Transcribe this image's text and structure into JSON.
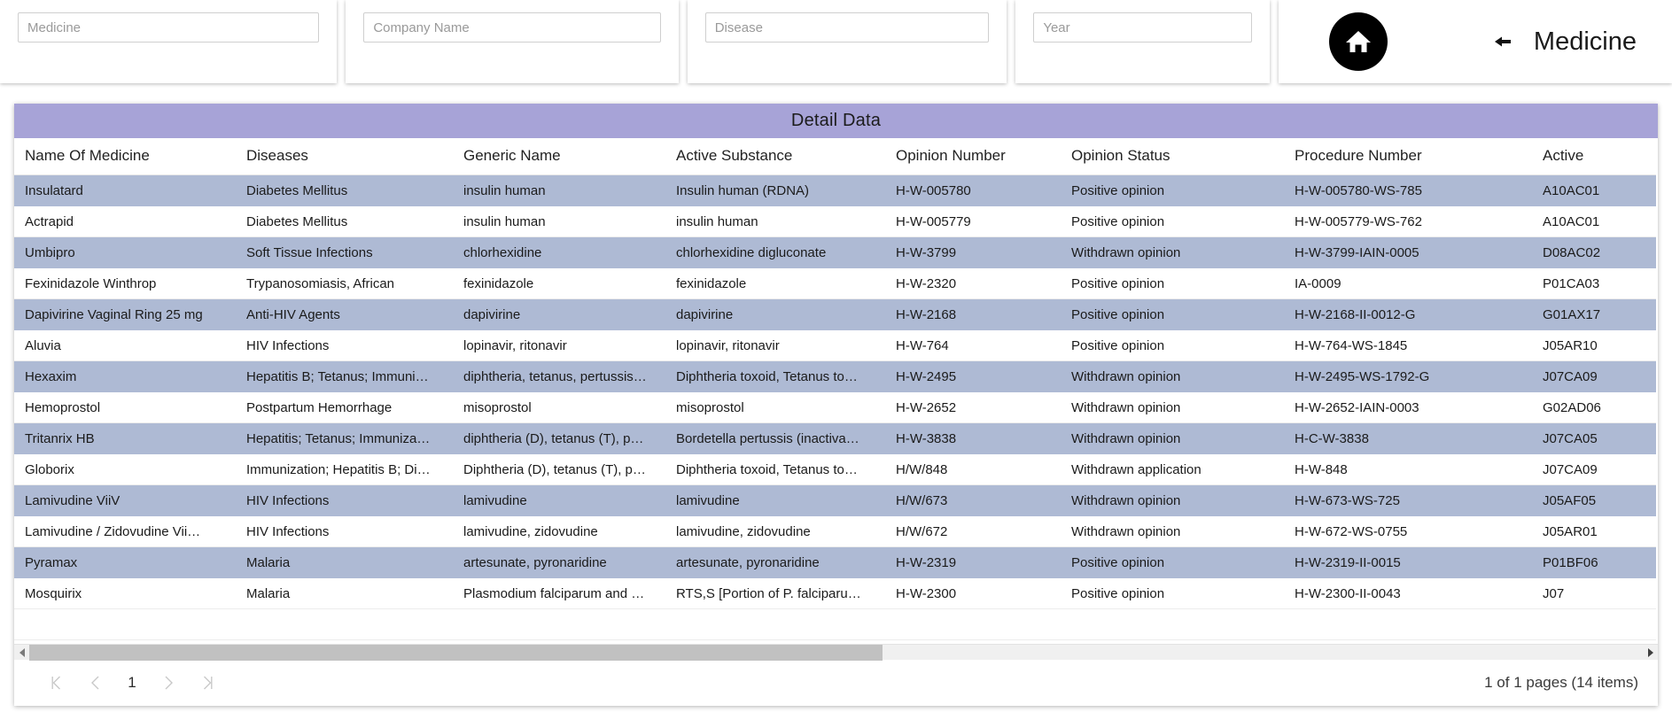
{
  "filters": [
    {
      "name": "medicine",
      "placeholder": "Medicine",
      "value": ""
    },
    {
      "name": "company-name",
      "placeholder": "Company Name",
      "value": ""
    },
    {
      "name": "disease",
      "placeholder": "Disease",
      "value": ""
    },
    {
      "name": "year",
      "placeholder": "Year",
      "value": ""
    }
  ],
  "header": {
    "home_icon": "home-icon",
    "back_icon": "arrow-left-icon",
    "title": "Medicine"
  },
  "grid": {
    "title": "Detail Data",
    "columns": [
      "Name Of Medicine",
      "Diseases",
      "Generic Name",
      "Active Substance",
      "Opinion Number",
      "Opinion Status",
      "Procedure Number",
      "Active"
    ],
    "rows": [
      [
        "Insulatard",
        "Diabetes Mellitus",
        "insulin human",
        "Insulin human (RDNA)",
        "H-W-005780",
        "Positive opinion",
        "H-W-005780-WS-785",
        "A10AC01"
      ],
      [
        "Actrapid",
        "Diabetes Mellitus",
        "insulin human",
        "insulin human",
        "H-W-005779",
        "Positive opinion",
        "H-W-005779-WS-762",
        "A10AC01"
      ],
      [
        "Umbipro",
        "Soft Tissue Infections",
        "chlorhexidine",
        "chlorhexidine digluconate",
        "H-W-3799",
        "Withdrawn opinion",
        "H-W-3799-IAIN-0005",
        "D08AC02"
      ],
      [
        "Fexinidazole Winthrop",
        "Trypanosomiasis, African",
        "fexinidazole",
        "fexinidazole",
        "H-W-2320",
        "Positive opinion",
        "IA-0009",
        "P01CA03"
      ],
      [
        "Dapivirine Vaginal Ring 25 mg",
        "Anti-HIV Agents",
        "dapivirine",
        "dapivirine",
        "H-W-2168",
        "Positive opinion",
        "H-W-2168-II-0012-G",
        "G01AX17"
      ],
      [
        "Aluvia",
        "HIV Infections",
        "lopinavir, ritonavir",
        "lopinavir, ritonavir",
        "H-W-764",
        "Positive opinion",
        "H-W-764-WS-1845",
        "J05AR10"
      ],
      [
        "Hexaxim",
        "Hepatitis B; Tetanus; Immuni…",
        "diphtheria, tetanus, pertussis…",
        "Diphtheria toxoid, Tetanus to…",
        "H-W-2495",
        "Withdrawn opinion",
        "H-W-2495-WS-1792-G",
        "J07CA09"
      ],
      [
        "Hemoprostol",
        "Postpartum Hemorrhage",
        "misoprostol",
        "misoprostol",
        "H-W-2652",
        "Withdrawn opinion",
        "H-W-2652-IAIN-0003",
        "G02AD06"
      ],
      [
        "Tritanrix HB",
        "Hepatitis; Tetanus; Immuniza…",
        "diphtheria (D), tetanus (T), p…",
        "Bordetella pertussis (inactiva…",
        "H-W-3838",
        "Withdrawn opinion",
        "H-C-W-3838",
        "J07CA05"
      ],
      [
        "Globorix",
        "Immunization; Hepatitis B; Di…",
        "Diphtheria (D), tetanus (T), p…",
        "Diphtheria toxoid, Tetanus to…",
        "H/W/848",
        "Withdrawn application",
        "H-W-848",
        "J07CA09"
      ],
      [
        "Lamivudine ViiV",
        "HIV Infections",
        "lamivudine",
        "lamivudine",
        "H/W/673",
        "Withdrawn opinion",
        "H-W-673-WS-725",
        "J05AF05"
      ],
      [
        "Lamivudine / Zidovudine Vii…",
        "HIV Infections",
        "lamivudine, zidovudine",
        "lamivudine, zidovudine",
        "H/W/672",
        "Withdrawn opinion",
        "H-W-672-WS-0755",
        "J05AR01"
      ],
      [
        "Pyramax",
        "Malaria",
        "artesunate, pyronaridine",
        "artesunate, pyronaridine",
        "H-W-2319",
        "Positive opinion",
        "H-W-2319-II-0015",
        "P01BF06"
      ],
      [
        "Mosquirix",
        "Malaria",
        "Plasmodium falciparum and …",
        "RTS,S [Portion of P. falciparu…",
        "H-W-2300",
        "Positive opinion",
        "H-W-2300-II-0043",
        "J07"
      ]
    ]
  },
  "scrollbar": {
    "left_arrow_icon": "triangle-left-icon",
    "right_arrow_icon": "triangle-right-icon"
  },
  "pager": {
    "first_label": "|<",
    "prev_label": "<",
    "current_page": "1",
    "next_label": ">",
    "last_label": ">|",
    "summary": "1 of 1 pages (14 items)"
  },
  "colors": {
    "grid_title_bg": "#a7a3d7",
    "row_alt_bg": "#aebad4",
    "scroll_thumb": "#c1c1c1"
  }
}
